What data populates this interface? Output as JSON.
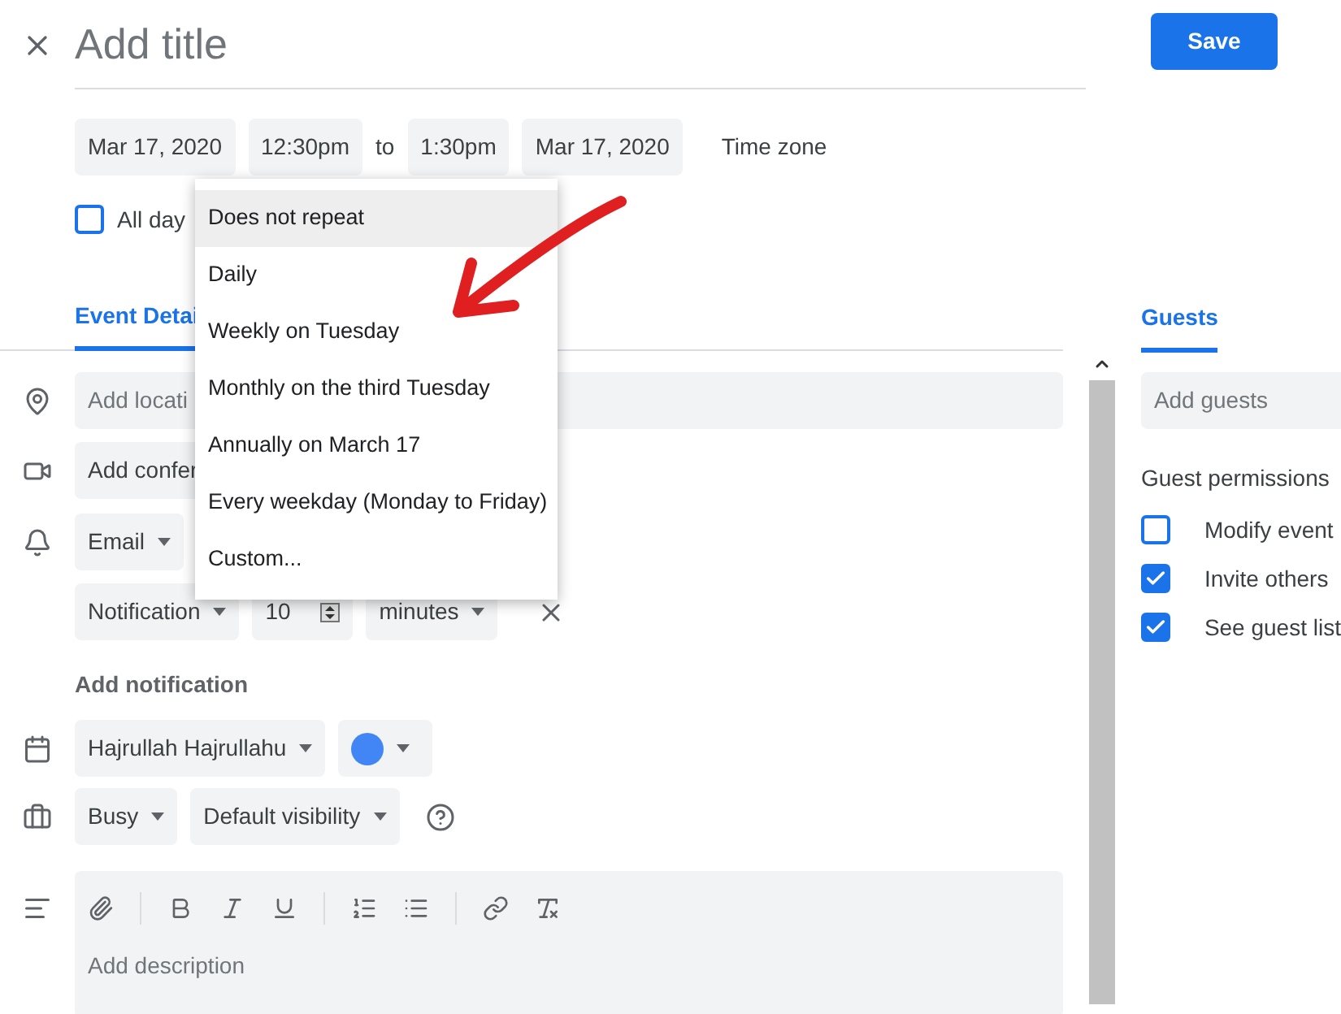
{
  "header": {
    "title_placeholder": "Add title",
    "save": "Save"
  },
  "dates": {
    "start_date": "Mar 17, 2020",
    "start_time": "12:30pm",
    "separator": "to",
    "end_time": "1:30pm",
    "end_date": "Mar 17, 2020",
    "time_zone": "Time zone"
  },
  "all_day": {
    "label": "All day",
    "checked": false
  },
  "repeat_menu": [
    {
      "label": "Does not repeat",
      "selected": true
    },
    {
      "label": "Daily",
      "selected": false
    },
    {
      "label": "Weekly on Tuesday",
      "selected": false
    },
    {
      "label": "Monthly on the third Tuesday",
      "selected": false
    },
    {
      "label": "Annually on March 17",
      "selected": false
    },
    {
      "label": "Every weekday (Monday to Friday)",
      "selected": false
    },
    {
      "label": "Custom...",
      "selected": false
    }
  ],
  "details_tab": {
    "label": "Event Detai",
    "selected": true
  },
  "details": {
    "location_placeholder": "Add locati",
    "conference": "Add confer",
    "notification_method": "Email",
    "notification": {
      "type": "Notification",
      "amount": "10",
      "unit": "minutes"
    },
    "add_notification": "Add notification",
    "calendar": "Hajrullah Hajrullahu",
    "availability": "Busy",
    "visibility": "Default visibility",
    "description_placeholder": "Add description"
  },
  "guests_tab": {
    "label": "Guests",
    "selected": true
  },
  "guests": {
    "placeholder": "Add guests",
    "permissions_title": "Guest permissions",
    "permissions": [
      {
        "label": "Modify event",
        "checked": false
      },
      {
        "label": "Invite others",
        "checked": true
      },
      {
        "label": "See guest list",
        "checked": true
      }
    ]
  }
}
